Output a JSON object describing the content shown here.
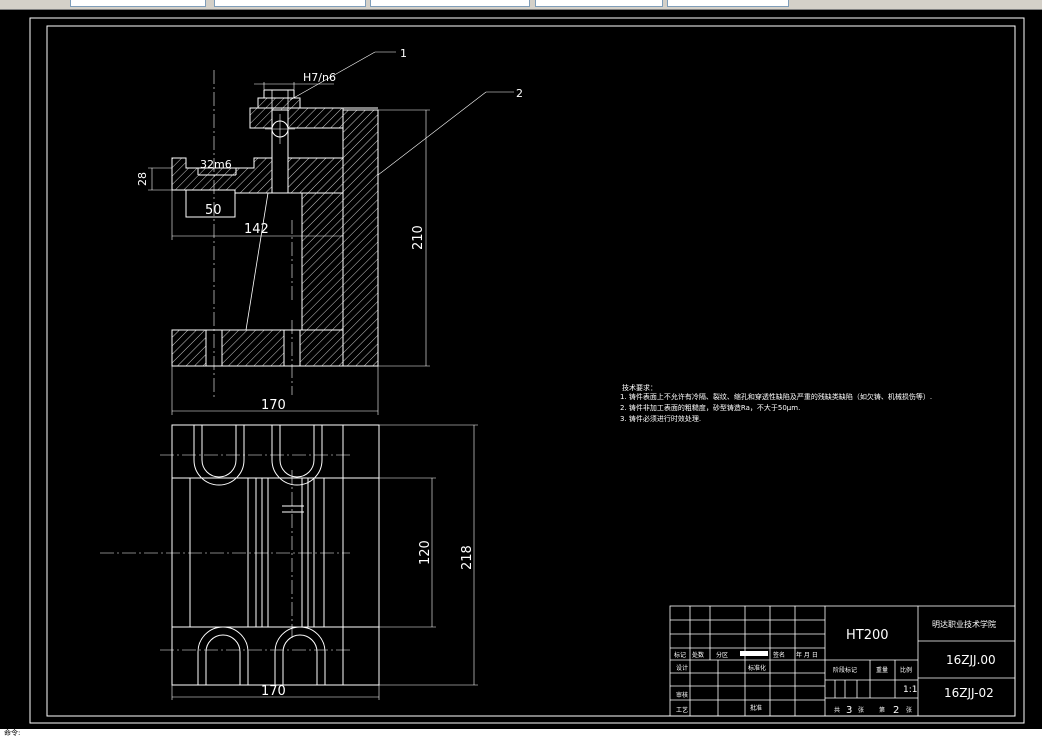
{
  "toolbar": {
    "fields": [
      "",
      "",
      "",
      "",
      "",
      ""
    ]
  },
  "status": {
    "command": "命令:"
  },
  "drawing": {
    "part_labels": [
      "1",
      "2"
    ],
    "fit_label_top": "H7/n6",
    "fit_label_left": "32m6",
    "dims": {
      "d28": "28",
      "d50": "50",
      "d142": "142",
      "d210": "210",
      "d170_top": "170",
      "d120": "120",
      "d218": "218",
      "d170_bottom": "170"
    },
    "tech_requirements": {
      "title": "技术要求：",
      "items": [
        "1. 铸件表面上不允许有冷隔、裂纹、缩孔和穿透性缺陷及严重的残缺类缺陷（如欠铸、机械损伤等）.",
        "2. 铸件非加工表面的粗糙度，砂型铸造Ra，不大于50μm.",
        "3. 铸件必须进行时效处理."
      ]
    },
    "title_block": {
      "material": "HT200",
      "school": "明达职业技术学院",
      "drawing_no": "16ZJJ.00",
      "part_no": "16ZJJ-02",
      "scale": "1:1",
      "sheets_total_label": "共",
      "sheets_total": "3",
      "sheets_unit": "张",
      "sheet_no_label": "第",
      "sheet_no": "2",
      "sheet_unit": "张",
      "cells": {
        "mark": "标记",
        "count": "处数",
        "zone": "分区",
        "change_doc": "更改文件号",
        "sign": "签名",
        "date": "年 月 日",
        "design": "设计",
        "standardize": "标准化",
        "stage_mark": "阶段标记",
        "weight": "重量",
        "ratio": "比例",
        "review": "审核",
        "process": "工艺",
        "approve": "批准"
      }
    }
  }
}
